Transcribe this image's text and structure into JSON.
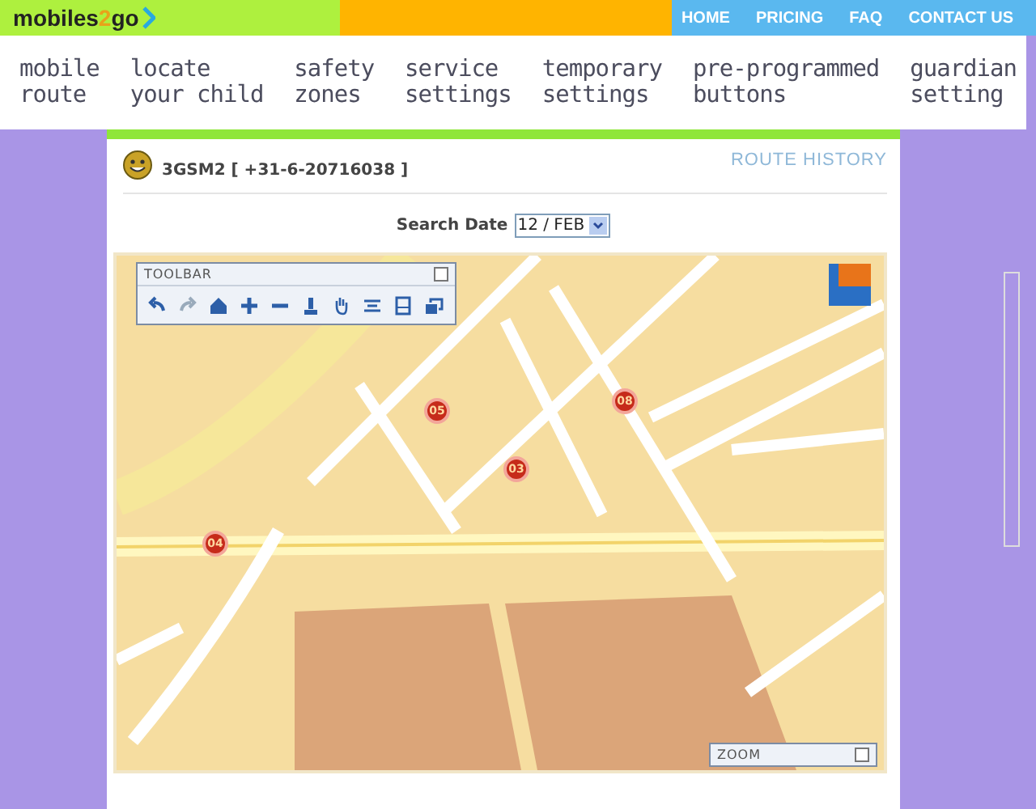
{
  "logo": {
    "text": "mobiles",
    "accent": "2",
    "tail": "go"
  },
  "top_links": [
    "HOME",
    "PRICING",
    "FAQ",
    "CONTACT US"
  ],
  "nav": [
    {
      "line1": "mobile",
      "line2": "route"
    },
    {
      "line1": "locate",
      "line2": "your child"
    },
    {
      "line1": "safety",
      "line2": "zones"
    },
    {
      "line1": "service",
      "line2": "settings"
    },
    {
      "line1": "temporary",
      "line2": "settings"
    },
    {
      "line1": "pre-programmed",
      "line2": "buttons"
    },
    {
      "line1": "guardian",
      "line2": "setting"
    }
  ],
  "device": {
    "label": "3GSM2 [ +31-6-20716038 ]"
  },
  "page_title": "ROUTE HISTORY",
  "search": {
    "label": "Search Date",
    "value": "12 / FEB"
  },
  "map": {
    "toolbar_title": "TOOLBAR",
    "zoom_title": "ZOOM",
    "route_points": [
      {
        "label": "05"
      },
      {
        "label": "08"
      },
      {
        "label": "03"
      },
      {
        "label": "04"
      }
    ]
  }
}
